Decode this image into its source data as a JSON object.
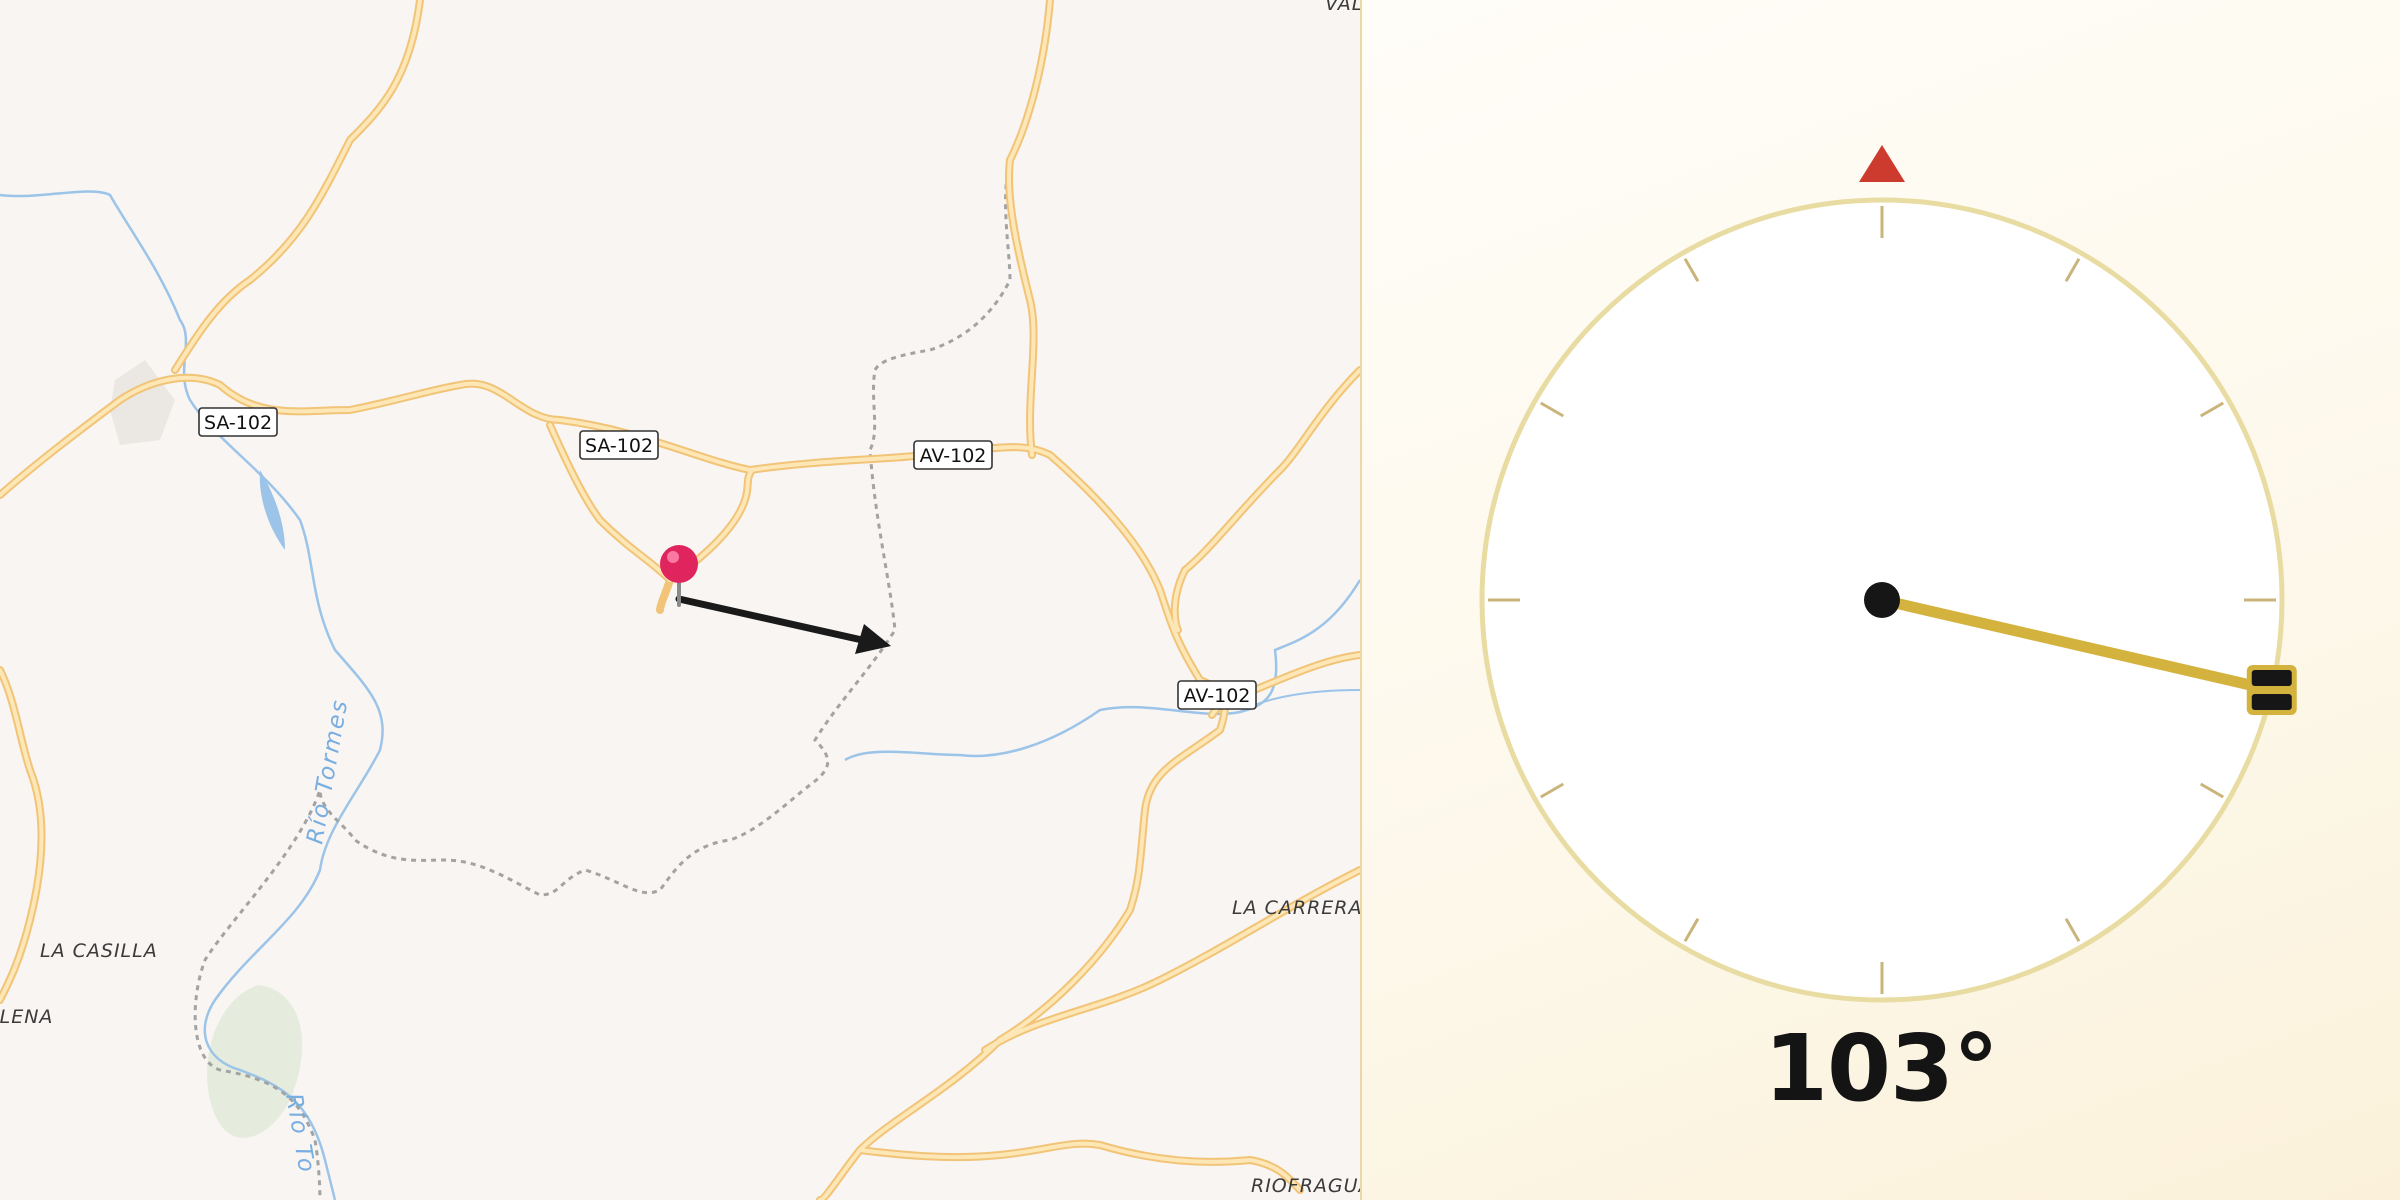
{
  "map": {
    "road_shields": [
      {
        "id": "sa102-west",
        "label": "SA-102"
      },
      {
        "id": "sa102-center",
        "label": "SA-102"
      },
      {
        "id": "av102-north",
        "label": "AV-102"
      },
      {
        "id": "av102-east",
        "label": "AV-102"
      }
    ],
    "places": [
      {
        "id": "la-casilla",
        "label": "LA CASILLA"
      },
      {
        "id": "dalena",
        "label": "DALENA"
      },
      {
        "id": "la-carrera",
        "label": "LA CARRERA"
      },
      {
        "id": "riofragua",
        "label": "RIOFRAGUA"
      },
      {
        "id": "val",
        "label": "VAL"
      }
    ],
    "rivers": [
      {
        "id": "rio-tormes-upper",
        "label": "Río Tormes"
      },
      {
        "id": "rio-tormes-lower",
        "label": "Río To"
      }
    ],
    "marker": {
      "icon": "pin-icon",
      "color": "#e0245e"
    },
    "direction_arrow": {
      "icon": "arrow-icon",
      "color": "#1a1a1a"
    }
  },
  "compass": {
    "heading_degrees": 103,
    "heading_text": "103°",
    "north_marker_color": "#cc3b2e",
    "needle_color": "#d4b23e",
    "ring_color": "#e8dca2"
  }
}
